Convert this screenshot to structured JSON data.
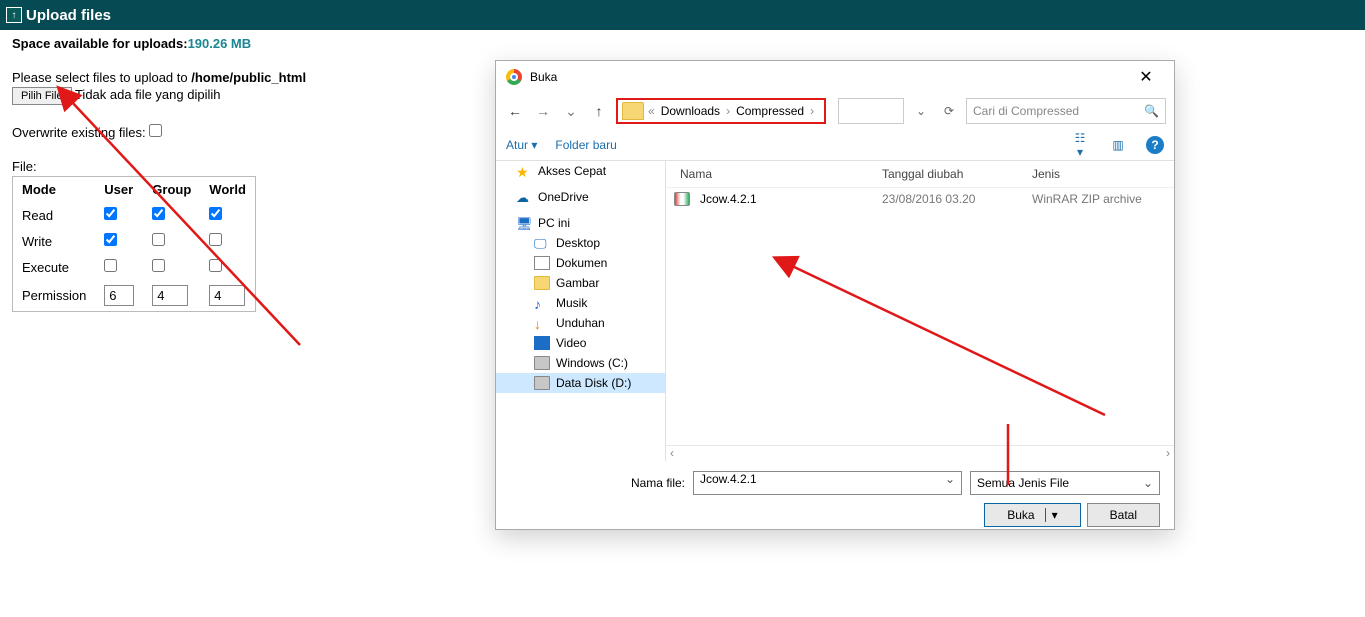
{
  "header": {
    "title": "Upload files"
  },
  "main": {
    "space_label": "Space available for uploads:",
    "space_value": "190.26 MB",
    "select_prompt": "Please select files to upload to ",
    "upload_path": "/home/public_html",
    "pilih_file": "Pilih File",
    "no_file": "Tidak ada file yang dipilih",
    "overwrite_label": "Overwrite existing files:",
    "file_label": "File:"
  },
  "perm": {
    "cols": {
      "mode": "Mode",
      "user": "User",
      "group": "Group",
      "world": "World"
    },
    "rows": {
      "read": "Read",
      "write": "Write",
      "execute": "Execute",
      "permission": "Permission"
    },
    "vals": {
      "user": "6",
      "group": "4",
      "world": "4"
    }
  },
  "dialog": {
    "title": "Buka",
    "crumbs": {
      "a": "«",
      "b": "Downloads",
      "c": "Compressed"
    },
    "search_placeholder": "Cari di Compressed",
    "toolbar": {
      "atur": "Atur",
      "folder_baru": "Folder baru"
    },
    "cols": {
      "name": "Nama",
      "date": "Tanggal diubah",
      "type": "Jenis"
    },
    "sidebar": {
      "quick": "Akses Cepat",
      "onedrive": "OneDrive",
      "pc": "PC ini",
      "desktop": "Desktop",
      "dokumen": "Dokumen",
      "gambar": "Gambar",
      "musik": "Musik",
      "unduhan": "Unduhan",
      "video": "Video",
      "cdrive": "Windows (C:)",
      "ddrive": "Data Disk (D:)"
    },
    "file": {
      "name": "Jcow.4.2.1",
      "date": "23/08/2016 03.20",
      "type": "WinRAR ZIP archive"
    },
    "footer": {
      "name_label": "Nama file:",
      "name_value": "Jcow.4.2.1",
      "type_value": "Semua Jenis File",
      "open": "Buka",
      "cancel": "Batal"
    }
  }
}
